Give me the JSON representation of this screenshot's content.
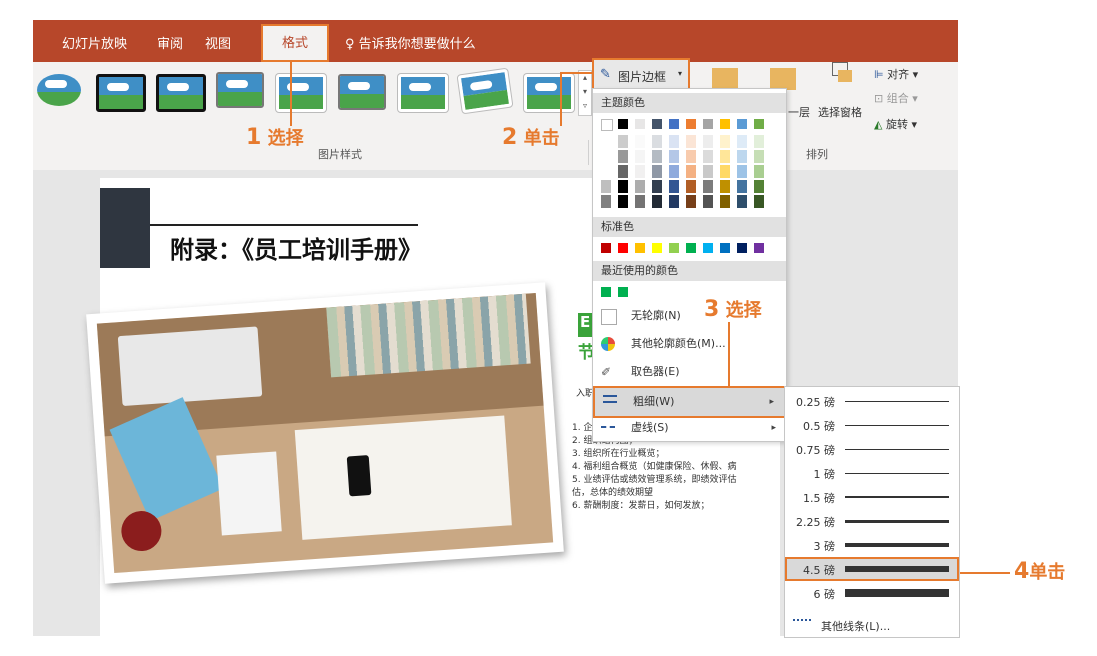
{
  "tabs": [
    {
      "label": "幻灯片放映"
    },
    {
      "label": "审阅"
    },
    {
      "label": "视图"
    },
    {
      "label": "格式"
    },
    {
      "label": "告诉我你想要做什么"
    }
  ],
  "ribbon": {
    "picture_styles_group": "图片样式",
    "picture_border_button": "图片边框",
    "arrange_group": "排列",
    "align": "对齐",
    "group": "组合",
    "rotate": "旋转",
    "layer_partial": "一层",
    "selection_pane": "选择窗格"
  },
  "slide": {
    "title": "附录：《员工培训手册》",
    "side_heading_partial_1": "E",
    "side_heading_partial_2": "节",
    "intro_partial": "入职",
    "lines": [
      "1. 企",
      "2. 组织结构图；",
      "3. 组织所在行业概览；",
      "4. 福利组合概览（如健康保险、休假、病",
      "5. 业绩评估或绩效管理系统，即绩效评估",
      "估，总体的绩效期望",
      "6. 薪酬制度：发薪日，如何发放；"
    ]
  },
  "dropdown": {
    "theme_colors_header": "主题颜色",
    "standard_colors_header": "标准色",
    "recent_colors_header": "最近使用的颜色",
    "no_outline": "无轮廓(N)",
    "more_colors": "其他轮廓颜色(M)...",
    "eyedropper": "取色器(E)",
    "weight": "粗细(W)",
    "dashes": "虚线(S)",
    "theme_top_row": [
      "#ffffff",
      "#000000",
      "#e7e6e6",
      "#44546a",
      "#4472c4",
      "#ed7d31",
      "#a5a5a5",
      "#ffc000",
      "#5b9bd5",
      "#70ad47"
    ],
    "standard_colors": [
      "#c00000",
      "#ff0000",
      "#ffc000",
      "#ffff00",
      "#92d050",
      "#00b050",
      "#00b0f0",
      "#0070c0",
      "#002060",
      "#7030a0"
    ],
    "recent_colors": [
      "#00b050",
      "#00b050"
    ]
  },
  "weights": {
    "options": [
      {
        "label": "0.25 磅",
        "pt": 0.25
      },
      {
        "label": "0.5 磅",
        "pt": 0.5
      },
      {
        "label": "0.75 磅",
        "pt": 0.75
      },
      {
        "label": "1 磅",
        "pt": 1
      },
      {
        "label": "1.5 磅",
        "pt": 1.5
      },
      {
        "label": "2.25 磅",
        "pt": 2.25
      },
      {
        "label": "3 磅",
        "pt": 3
      },
      {
        "label": "4.5 磅",
        "pt": 4.5
      },
      {
        "label": "6 磅",
        "pt": 6
      }
    ],
    "selected": "4.5 磅",
    "more_lines": "其他线条(L)..."
  },
  "annotations": {
    "step1_num": "1",
    "step1_text": "选择",
    "step2_num": "2",
    "step2_text": "单击",
    "step3_num": "3",
    "step3_text": "选择",
    "step4_num": "4",
    "step4_text": "单击"
  },
  "colors": {
    "ribbon_accent": "#b7472a",
    "highlight": "#e67a2e"
  }
}
